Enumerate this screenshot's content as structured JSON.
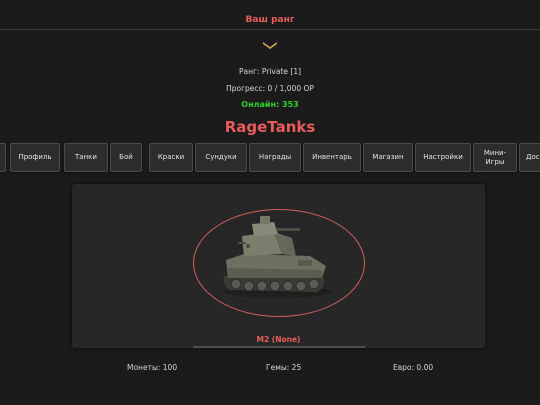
{
  "rank": {
    "title": "Ваш ранг",
    "rank_line": "Ранг: Private [1]",
    "progress_line": "Прогресс: 0 / 1,000 ОР",
    "online_line": "Онлайн: 353"
  },
  "brand": "RageTanks",
  "nav": [
    {
      "label": ""
    },
    {
      "label": "Профиль"
    },
    {
      "label": "Танки"
    },
    {
      "label": "Бой"
    },
    {
      "label": "Краски"
    },
    {
      "label": "Сундуки"
    },
    {
      "label": "Награды"
    },
    {
      "label": "Инвентарь"
    },
    {
      "label": "Магазин"
    },
    {
      "label": "Настройки"
    },
    {
      "label": "Мини-\nИгры"
    },
    {
      "label": "Дос"
    }
  ],
  "tank": {
    "name": "M2 (None)"
  },
  "currency": {
    "coins": "Монеты: 100",
    "gems": "Гемы: 25",
    "euro": "Евро: 0.00"
  },
  "colors": {
    "accent": "#e85c5c",
    "online": "#2ed12e",
    "background": "#1b1b1b"
  }
}
